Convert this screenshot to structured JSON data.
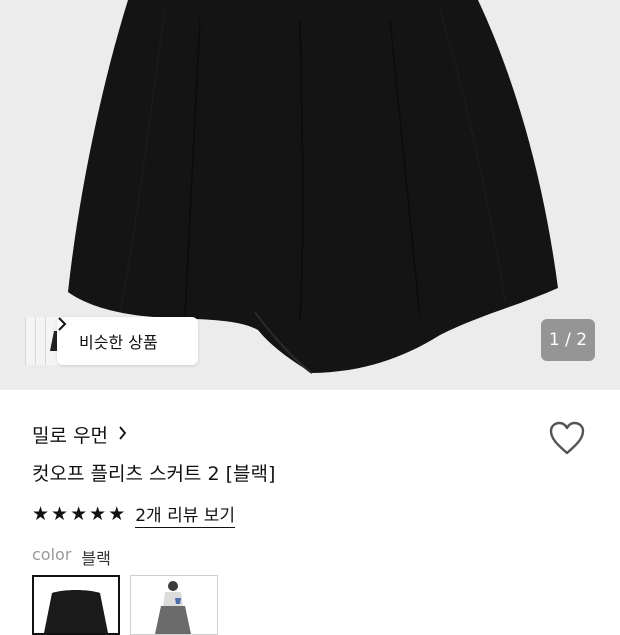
{
  "gallery": {
    "similar_button_label": "비슷한 상품",
    "pager_text": "1 / 2"
  },
  "product": {
    "brand": "밀로 우먼",
    "title": "컷오프 플리츠 스커트 2 [블랙]",
    "rating_stars": 5,
    "review_link": "2개 리뷰 보기",
    "color_label": "color",
    "color_value": "블랙"
  },
  "icons": {
    "brand_chevron": "chevron-right-icon",
    "heart": "heart-outline-icon",
    "star": "star-filled-icon"
  },
  "colors": {
    "hero_background": "#ececec",
    "skirt": "#141414"
  }
}
